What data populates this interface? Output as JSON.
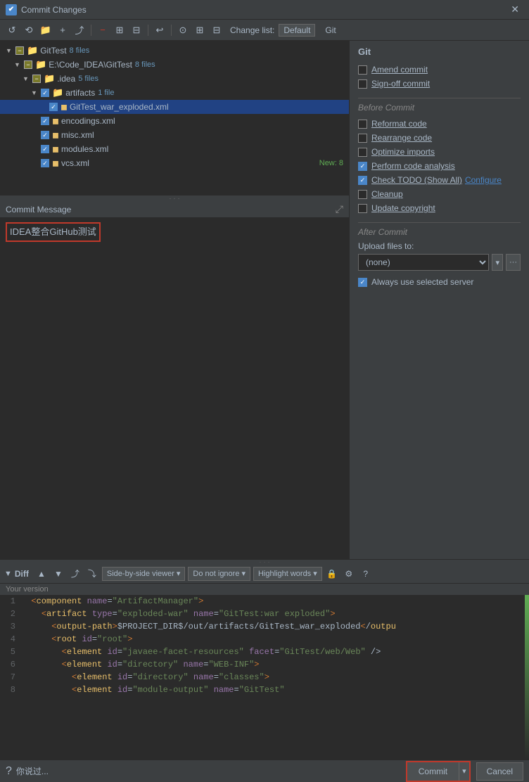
{
  "window": {
    "title": "Commit Changes",
    "icon": "✔"
  },
  "toolbar": {
    "change_list_label": "Change list:",
    "change_list_value": "Default",
    "git_label": "Git"
  },
  "file_tree": {
    "items": [
      {
        "indent": 1,
        "type": "folder",
        "checked": "partial",
        "expanded": true,
        "label": "GitTest",
        "count": "8 files"
      },
      {
        "indent": 2,
        "type": "folder",
        "checked": "partial",
        "expanded": true,
        "label": "E:\\Code_IDEA\\GitTest",
        "count": "8 files"
      },
      {
        "indent": 3,
        "type": "folder",
        "checked": "partial",
        "expanded": true,
        "label": ".idea",
        "count": "5 files"
      },
      {
        "indent": 4,
        "type": "folder",
        "checked": "checked",
        "expanded": true,
        "label": "artifacts",
        "count": "1 file"
      },
      {
        "indent": 5,
        "type": "xml_file",
        "checked": "checked",
        "expanded": false,
        "label": "GitTest_war_exploded.xml",
        "selected": true
      },
      {
        "indent": 4,
        "type": "xml_file",
        "checked": "checked",
        "expanded": false,
        "label": "encodings.xml"
      },
      {
        "indent": 4,
        "type": "xml_file",
        "checked": "checked",
        "expanded": false,
        "label": "misc.xml"
      },
      {
        "indent": 4,
        "type": "xml_file",
        "checked": "checked",
        "expanded": false,
        "label": "modules.xml"
      },
      {
        "indent": 4,
        "type": "xml_file",
        "checked": "checked",
        "expanded": false,
        "label": "vcs.xml"
      }
    ],
    "new_badge": "New: 8"
  },
  "commit_message": {
    "header": "Commit Message",
    "text": "IDEA整合GitHub测试"
  },
  "git_options": {
    "title": "Git",
    "amend_commit": {
      "label": "Amend commit",
      "checked": false
    },
    "sign_off_commit": {
      "label": "Sign-off commit",
      "checked": false
    },
    "before_commit_title": "Before Commit",
    "reformat_code": {
      "label": "Reformat code",
      "checked": false
    },
    "rearrange_code": {
      "label": "Rearrange code",
      "checked": false
    },
    "optimize_imports": {
      "label": "Optimize imports",
      "checked": false
    },
    "perform_code_analysis": {
      "label": "Perform code analysis",
      "checked": true
    },
    "check_todo": {
      "label": "Check TODO (Show All)",
      "checked": true,
      "link": "Configure"
    },
    "cleanup": {
      "label": "Cleanup",
      "checked": false
    },
    "update_copyright": {
      "label": "Update copyright",
      "checked": false
    },
    "after_commit_title": "After Commit",
    "upload_files_label": "Upload files to:",
    "upload_select_value": "(none)",
    "always_use_server": {
      "label": "Always use selected server",
      "checked": true
    }
  },
  "diff": {
    "title": "Diff",
    "your_version_label": "Your version",
    "toolbar": {
      "side_by_side": "Side-by-side viewer",
      "do_not_ignore": "Do not ignore",
      "highlight_words": "Highlight words"
    },
    "code_lines": [
      {
        "num": "1",
        "content": "  <component name=\"ArtifactManager\">"
      },
      {
        "num": "2",
        "content": "    <artifact type=\"exploded-war\" name=\"GitTest:war exploded\">"
      },
      {
        "num": "3",
        "content": "      <output-path>$PROJECT_DIR$/out/artifacts/GitTest_war_exploded</output-path"
      },
      {
        "num": "4",
        "content": "      <root id=\"root\">"
      },
      {
        "num": "5",
        "content": "        <element id=\"javaee-facet-resources\" facet=\"GitTest/web/Web\" />"
      },
      {
        "num": "6",
        "content": "        <element id=\"directory\" name=\"WEB-INF\">"
      },
      {
        "num": "7",
        "content": "          <element id=\"directory\" name=\"classes\">"
      },
      {
        "num": "8",
        "content": "          <element id=\"module-output\" name=\"GitTest\""
      }
    ]
  },
  "bottom_bar": {
    "help_icon": "?",
    "tooltip_text": "你说过...",
    "commit_label": "Commit",
    "commit_dropdown": "▾",
    "cancel_label": "Cancel"
  }
}
